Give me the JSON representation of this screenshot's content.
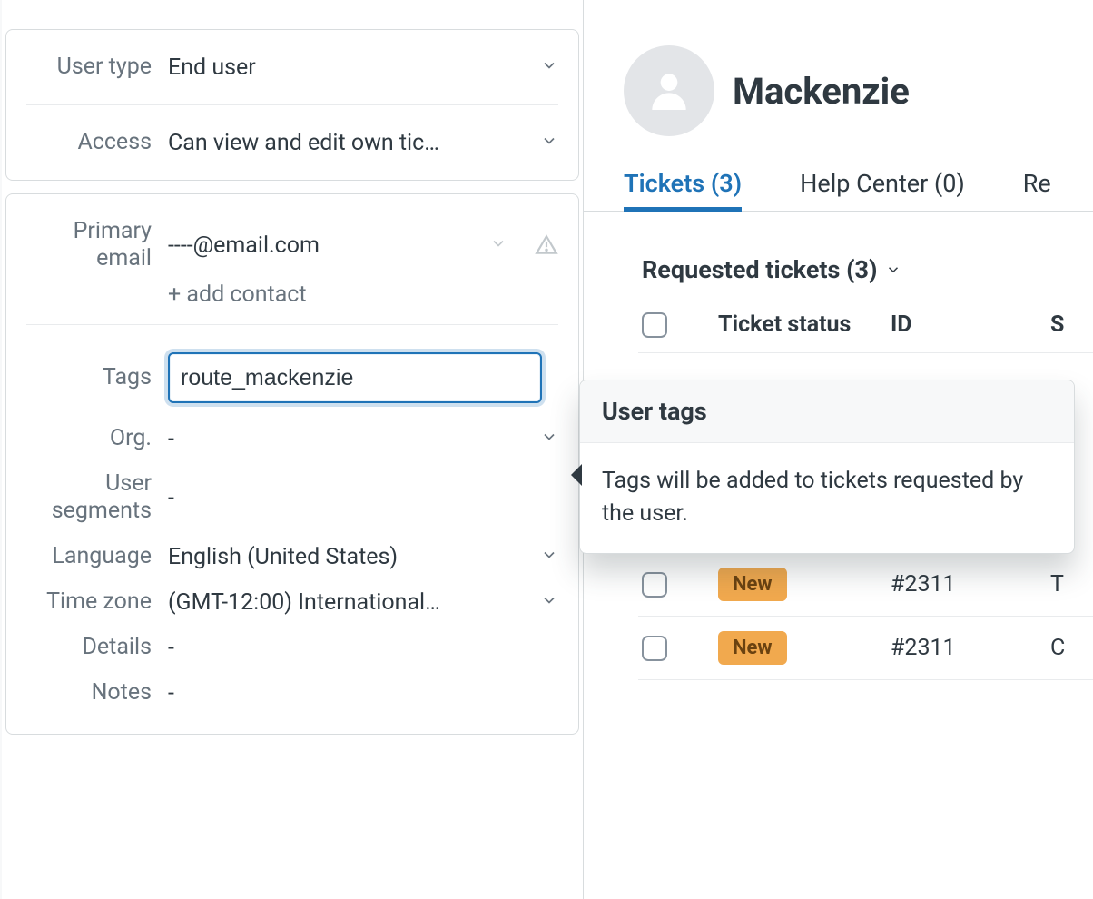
{
  "sidebar": {
    "fields": {
      "user_type": {
        "label": "User type",
        "value": "End user"
      },
      "access": {
        "label": "Access",
        "value": "Can view and edit own tic…"
      },
      "primary_email": {
        "label": "Primary email",
        "value": "----@email.com",
        "add_contact_label": "+ add contact"
      },
      "tags": {
        "label": "Tags",
        "value": "route_mackenzie"
      },
      "org": {
        "label": "Org.",
        "value": "-"
      },
      "user_segments": {
        "label": "User segments",
        "value": "-"
      },
      "language": {
        "label": "Language",
        "value": "English (United States)"
      },
      "time_zone": {
        "label": "Time zone",
        "value": "(GMT-12:00) International…"
      },
      "details": {
        "label": "Details",
        "value": "-"
      },
      "notes": {
        "label": "Notes",
        "value": "-"
      }
    }
  },
  "profile": {
    "name": "Mackenzie"
  },
  "tabs": {
    "tickets_label": "Tickets (3)",
    "help_center_label": "Help Center (0)",
    "related_label": "Re"
  },
  "tickets": {
    "section_label": "Requested tickets (3)",
    "columns": {
      "status": "Ticket status",
      "id": "ID",
      "s": "S"
    },
    "rows": [
      {
        "status": "New",
        "id": "#2311"
      },
      {
        "status": "New",
        "id": "#2311"
      }
    ]
  },
  "tooltip": {
    "title": "User tags",
    "body": "Tags will be added to tickets requested by the user."
  }
}
